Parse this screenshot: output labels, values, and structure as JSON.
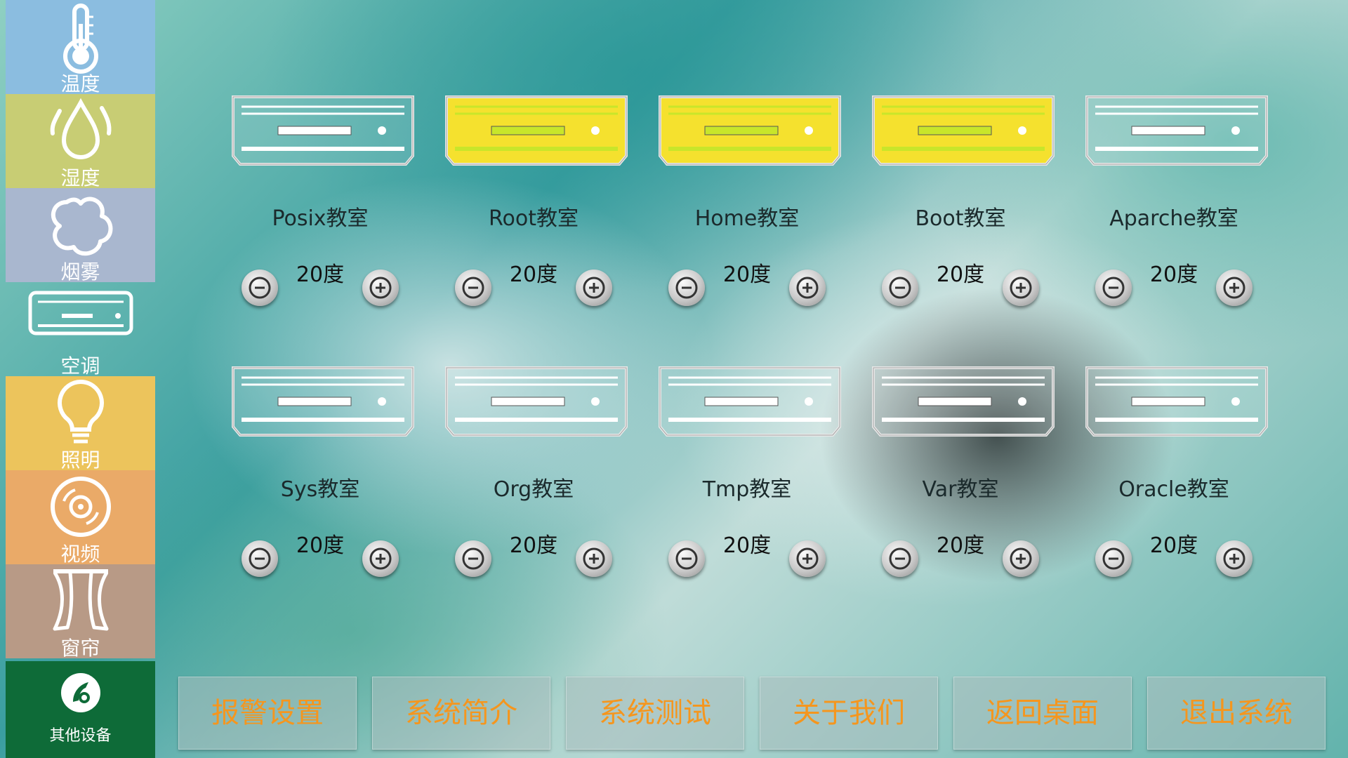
{
  "sidebar": {
    "items": [
      {
        "label": "温度",
        "icon": "thermometer-icon",
        "color": "#8bbde0"
      },
      {
        "label": "湿度",
        "icon": "water-drops-icon",
        "color": "#c8cd74"
      },
      {
        "label": "烟雾",
        "icon": "smoke-icon",
        "color": "#a9b7cf"
      },
      {
        "label": "空调",
        "icon": "air-conditioner-icon",
        "color": "transparent"
      },
      {
        "label": "照明",
        "icon": "lightbulb-icon",
        "color": "#ecc45c"
      },
      {
        "label": "视频",
        "icon": "video-disc-icon",
        "color": "#eaaa68"
      },
      {
        "label": "窗帘",
        "icon": "curtain-icon",
        "color": "#b89a86"
      },
      {
        "label": "其他设备",
        "icon": "other-devices-icon",
        "color": "#0e6b38"
      }
    ]
  },
  "devices": [
    {
      "name": "Posix教室",
      "temp": "20度",
      "active": false
    },
    {
      "name": "Root教室",
      "temp": "20度",
      "active": true
    },
    {
      "name": "Home教室",
      "temp": "20度",
      "active": true
    },
    {
      "name": "Boot教室",
      "temp": "20度",
      "active": true
    },
    {
      "name": "Aparche教室",
      "temp": "20度",
      "active": false
    },
    {
      "name": "Sys教室",
      "temp": "20度",
      "active": false
    },
    {
      "name": "Org教室",
      "temp": "20度",
      "active": false
    },
    {
      "name": "Tmp教室",
      "temp": "20度",
      "active": false
    },
    {
      "name": "Var教室",
      "temp": "20度",
      "active": false
    },
    {
      "name": "Oracle教室",
      "temp": "20度",
      "active": false
    }
  ],
  "colors": {
    "active_fill": "#f5e12e",
    "active_line": "#c8e62a",
    "inactive_line": "#ffffff",
    "button_text": "#f5961e"
  },
  "bottom_buttons": [
    {
      "label": "报警设置"
    },
    {
      "label": "系统简介"
    },
    {
      "label": "系统测试"
    },
    {
      "label": "关于我们"
    },
    {
      "label": "返回桌面"
    },
    {
      "label": "退出系统"
    }
  ]
}
